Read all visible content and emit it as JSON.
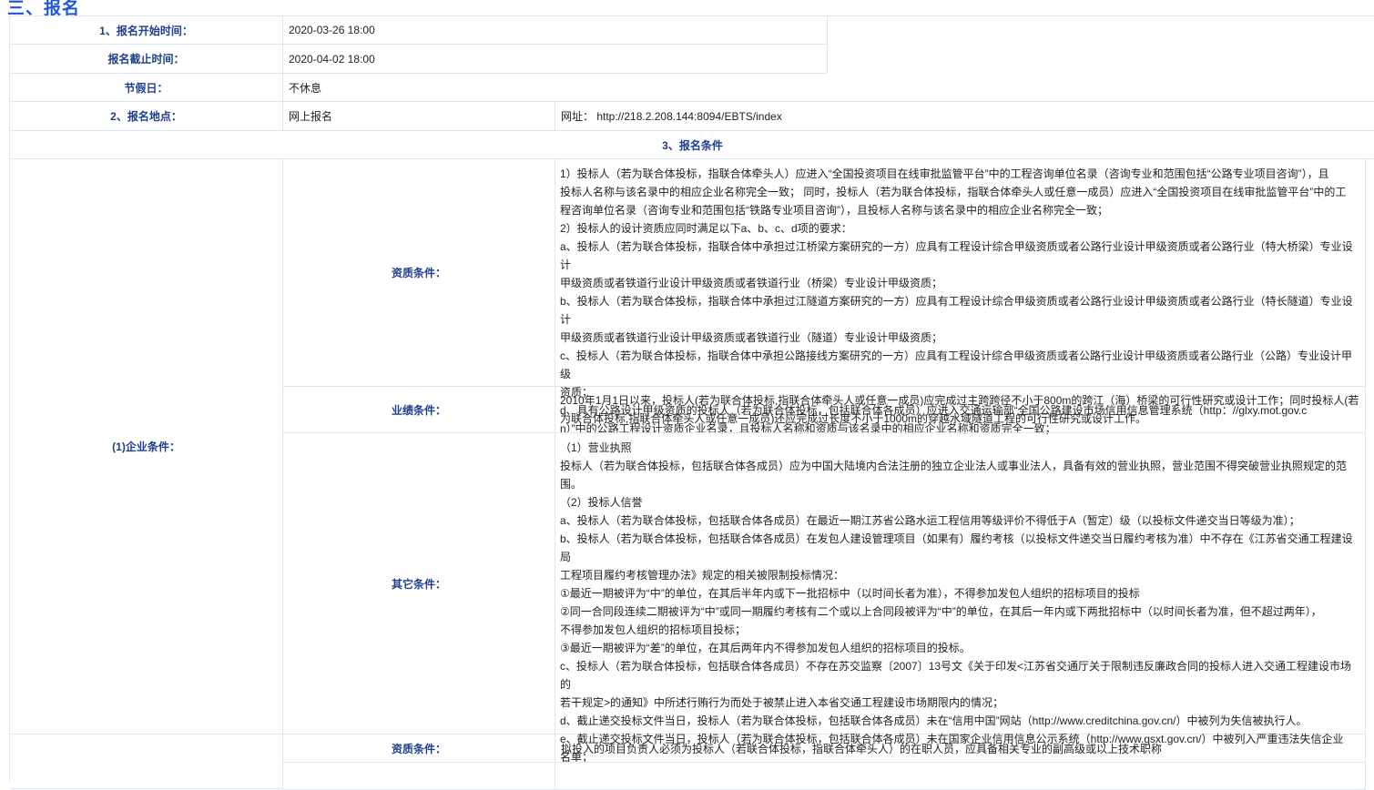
{
  "section_heading": "三、报名",
  "rows": {
    "start_label": "1、报名开始时间：",
    "start_value": "2020-03-26 18:00",
    "end_label": "报名截止时间：",
    "end_value": "2020-04-02 18:00",
    "holiday_label": "节假日：",
    "holiday_value": "不休息",
    "location_label": "2、报名地点：",
    "location_value": "网上报名",
    "website": "网址： http://218.2.208.144:8094/EBTS/index",
    "conditions_header": "3、报名条件"
  },
  "enterprise": {
    "label": "(1)企业条件：",
    "qualification_label": "资质条件：",
    "qualification_lines": [
      "1）投标人（若为联合体投标，指联合体牵头人）应进入“全国投资项目在线审批监管平台”中的工程咨询单位名录（咨询专业和范围包括“公路专业项目咨询”），且",
      "投标人名称与该名录中的相应企业名称完全一致； 同时，投标人（若为联合体投标，指联合体牵头人或任意一成员）应进入“全国投资项目在线审批监管平台”中的工",
      "程咨询单位名录（咨询专业和范围包括“铁路专业项目咨询”），且投标人名称与该名录中的相应企业名称完全一致；",
      "2）投标人的设计资质应同时满足以下a、b、c、d项的要求：",
      "a、投标人（若为联合体投标，指联合体中承担过江桥梁方案研究的一方）应具有工程设计综合甲级资质或者公路行业设计甲级资质或者公路行业（特大桥梁）专业设计",
      "甲级资质或者铁道行业设计甲级资质或者铁道行业（桥梁）专业设计甲级资质；",
      "b、投标人（若为联合体投标，指联合体中承担过江隧道方案研究的一方）应具有工程设计综合甲级资质或者公路行业设计甲级资质或者公路行业（特长隧道）专业设计",
      "甲级资质或者铁道行业设计甲级资质或者铁道行业（隧道）专业设计甲级资质；",
      "c、投标人（若为联合体投标，指联合体中承担公路接线方案研究的一方）应具有工程设计综合甲级资质或者公路行业设计甲级资质或者公路行业（公路）专业设计甲级",
      "资质；",
      "d、具有公路设计甲级资质的投标人（若为联合体投标，包括联合体各成员）应进入交通运输部“全国公路建设市场信用信息管理系统（http：//glxy.mot.gov.c",
      "n）”中的公路工程设计资质企业名录，且投标人名称和资质与该名录中的相应企业名称和资质完全一致；"
    ],
    "performance_label": "业绩条件：",
    "performance_lines": [
      "2010年1月1日以来，投标人(若为联合体投标,指联合体牵头人或任意一成员)应完成过主跨跨径不小于800m的跨江（海）桥梁的可行性研究或设计工作；同时投标人(若",
      "为联合体投标,指联合体牵头人或任意一成员)还应完成过长度不小于1000m的穿越水域隧道工程的可行性研究或设计工作。"
    ],
    "other_label": "其它条件：",
    "other_lines": [
      "（1）营业执照",
      "投标人（若为联合体投标，包括联合体各成员）应为中国大陆境内合法注册的独立企业法人或事业法人，具备有效的营业执照，营业范围不得突破营业执照规定的范",
      "围。",
      "（2）投标人信誉",
      "a、投标人（若为联合体投标，包括联合体各成员）在最近一期江苏省公路水运工程信用等级评价不得低于A（暂定）级（以投标文件递交当日等级为准）；",
      "b、投标人（若为联合体投标，包括联合体各成员）在发包人建设管理项目（如果有）履约考核（以投标文件递交当日履约考核为准）中不存在《江苏省交通工程建设局",
      "工程项目履约考核管理办法》规定的相关被限制投标情况：",
      "①最近一期被评为“中”的单位，在其后半年内或下一批招标中（以时间长者为准），不得参加发包人组织的招标项目的投标",
      "②同一合同段连续二期被评为“中”或同一期履约考核有二个或以上合同段被评为“中”的单位，在其后一年内或下两批招标中（以时间长者为准，但不超过两年），",
      "不得参加发包人组织的招标项目投标；",
      "③最近一期被评为“差”的单位，在其后两年内不得参加发包人组织的招标项目的投标。",
      "c、投标人（若为联合体投标，包括联合体各成员）不存在苏交监察〔2007〕13号文《关于印发<江苏省交通厅关于限制违反廉政合同的投标人进入交通工程建设市场的",
      "若干规定>的通知》中所述行贿行为而处于被禁止进入本省交通工程建设市场期限内的情况；",
      "d、截止递交投标文件当日，投标人（若为联合体投标，包括联合体各成员）未在“信用中国”网站（http://www.creditchina.gov.cn/）中被列为失信被执行人。",
      "e、截止递交投标文件当日，投标人（若为联合体投标，包括联合体各成员）未在国家企业信用信息公示系统（http://www.gsxt.gov.cn/）中被列入严重违法失信企业",
      "名单；"
    ]
  },
  "personnel": {
    "qualification_label": "资质条件：",
    "qualification_text": "拟投入的项目负责人必须为投标人（若联合体投标，指联合体牵头人）的在职人员，应具备相关专业的副高级或以上技术职称"
  }
}
